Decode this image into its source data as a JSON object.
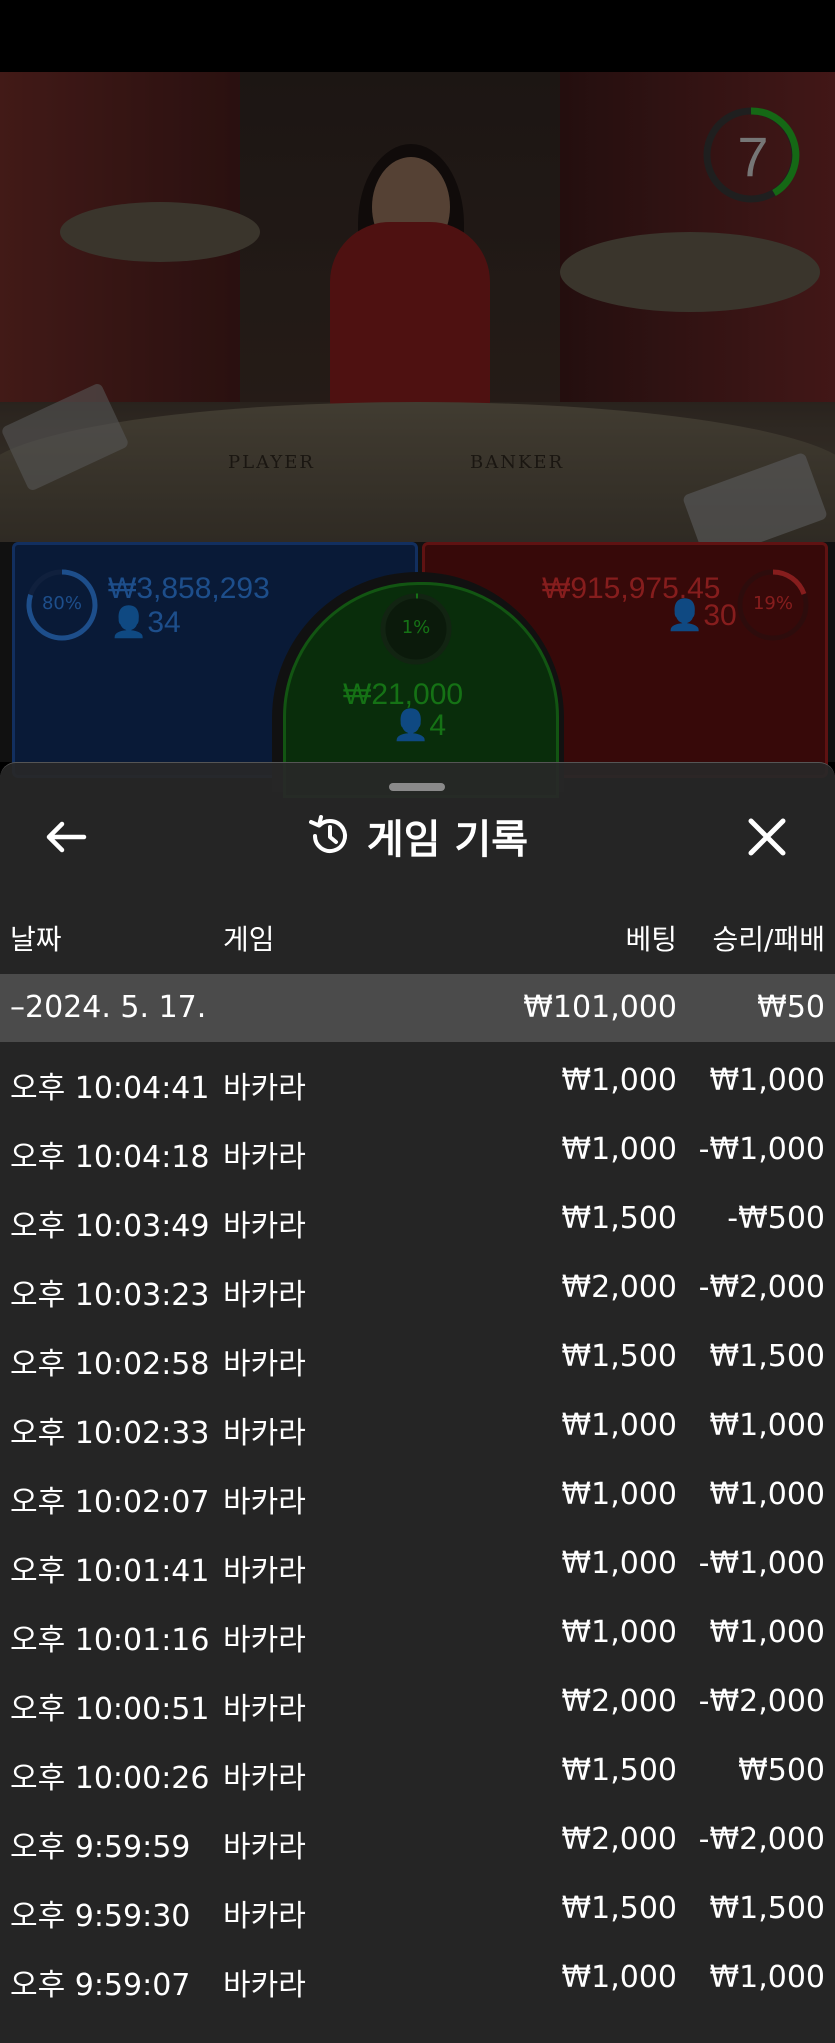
{
  "video": {
    "countdown": "7",
    "table_labels": {
      "player": "PLAYER",
      "banker": "BANKER"
    }
  },
  "bets": {
    "player": {
      "percent": "80%",
      "amount": "₩3,858,293",
      "players": "34",
      "color": "#2f7fe0"
    },
    "tie": {
      "percent": "1%",
      "amount": "₩21,000",
      "players": "4",
      "color": "#23b823"
    },
    "banker": {
      "percent": "19%",
      "amount": "₩915,975.45",
      "players": "30",
      "color": "#d93030"
    }
  },
  "sheet": {
    "title": "게임 기록",
    "columns": {
      "date": "날짜",
      "game": "게임",
      "bet": "베팅",
      "result": "승리/패배"
    },
    "summary": {
      "date": "–2024. 5. 17.",
      "bet": "₩101,000",
      "result": "₩50"
    },
    "rows": [
      {
        "time": "오후 10:04:41",
        "game": "바카라",
        "bet": "₩1,000",
        "result": "₩1,000"
      },
      {
        "time": "오후 10:04:18",
        "game": "바카라",
        "bet": "₩1,000",
        "result": "-₩1,000"
      },
      {
        "time": "오후 10:03:49",
        "game": "바카라",
        "bet": "₩1,500",
        "result": "-₩500"
      },
      {
        "time": "오후 10:03:23",
        "game": "바카라",
        "bet": "₩2,000",
        "result": "-₩2,000"
      },
      {
        "time": "오후 10:02:58",
        "game": "바카라",
        "bet": "₩1,500",
        "result": "₩1,500"
      },
      {
        "time": "오후 10:02:33",
        "game": "바카라",
        "bet": "₩1,000",
        "result": "₩1,000"
      },
      {
        "time": "오후 10:02:07",
        "game": "바카라",
        "bet": "₩1,000",
        "result": "₩1,000"
      },
      {
        "time": "오후 10:01:41",
        "game": "바카라",
        "bet": "₩1,000",
        "result": "-₩1,000"
      },
      {
        "time": "오후 10:01:16",
        "game": "바카라",
        "bet": "₩1,000",
        "result": "₩1,000"
      },
      {
        "time": "오후 10:00:51",
        "game": "바카라",
        "bet": "₩2,000",
        "result": "-₩2,000"
      },
      {
        "time": "오후 10:00:26",
        "game": "바카라",
        "bet": "₩1,500",
        "result": "₩500"
      },
      {
        "time": "오후 9:59:59",
        "game": "바카라",
        "bet": "₩2,000",
        "result": "-₩2,000"
      },
      {
        "time": "오후 9:59:30",
        "game": "바카라",
        "bet": "₩1,500",
        "result": "₩1,500"
      },
      {
        "time": "오후 9:59:07",
        "game": "바카라",
        "bet": "₩1,000",
        "result": "₩1,000"
      }
    ]
  },
  "icons": {
    "back": "arrow-left-icon",
    "history": "history-icon",
    "close": "close-icon"
  }
}
